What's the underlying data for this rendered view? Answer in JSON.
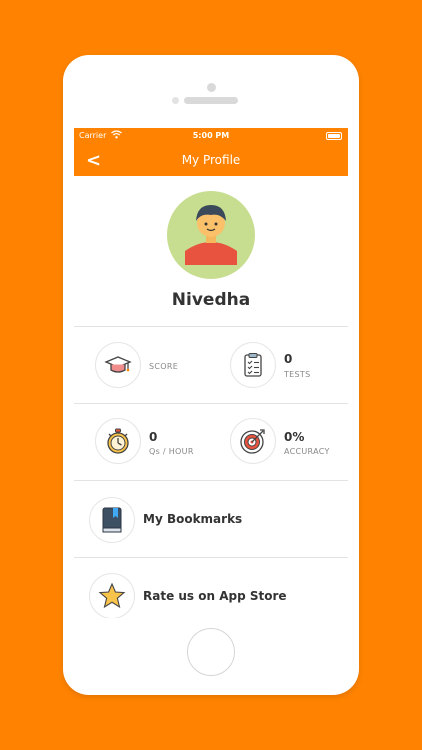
{
  "status": {
    "carrier": "Carrier",
    "time": "5:00 PM"
  },
  "nav": {
    "back_symbol": "<",
    "title": "My Profile"
  },
  "profile": {
    "name": "Nivedha"
  },
  "stats": {
    "score": {
      "value": "",
      "label": "SCORE",
      "icon": "graduation-cap-icon"
    },
    "tests": {
      "value": "0",
      "label": "TESTS",
      "icon": "clipboard-checklist-icon"
    },
    "qs_per_hour": {
      "value": "0",
      "label": "Qs / HOUR",
      "icon": "stopwatch-icon"
    },
    "accuracy": {
      "value": "0%",
      "label": "ACCURACY",
      "icon": "target-icon"
    }
  },
  "menu": [
    {
      "label": "My Bookmarks",
      "icon": "bookmark-book-icon"
    },
    {
      "label": "Rate us on App Store",
      "icon": "star-icon"
    }
  ],
  "colors": {
    "brand": "#FF8300",
    "avatar_bg": "#C7DD8F",
    "avatar_shirt": "#E8533F"
  }
}
